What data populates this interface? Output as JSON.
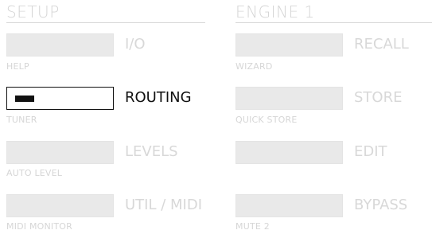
{
  "setup": {
    "title": "SETUP",
    "rows": [
      {
        "label": "I/O",
        "sub": "HELP",
        "active": false
      },
      {
        "label": "ROUTING",
        "sub": "TUNER",
        "active": true
      },
      {
        "label": "LEVELS",
        "sub": "AUTO LEVEL",
        "active": false
      },
      {
        "label": "UTIL / MIDI",
        "sub": "MIDI MONITOR",
        "active": false
      }
    ]
  },
  "engine": {
    "title": "ENGINE  1",
    "rows": [
      {
        "label": "RECALL",
        "sub": "WIZARD",
        "active": false
      },
      {
        "label": "STORE",
        "sub": "QUICK STORE",
        "active": false
      },
      {
        "label": "EDIT",
        "sub": "",
        "active": false
      },
      {
        "label": "BYPASS",
        "sub": "MUTE 2",
        "active": false
      }
    ]
  },
  "colors": {
    "inactive_text": "#d8d8d8",
    "active_text": "#111111",
    "button_fill": "#e9e9e9",
    "active_border": "#111111"
  }
}
